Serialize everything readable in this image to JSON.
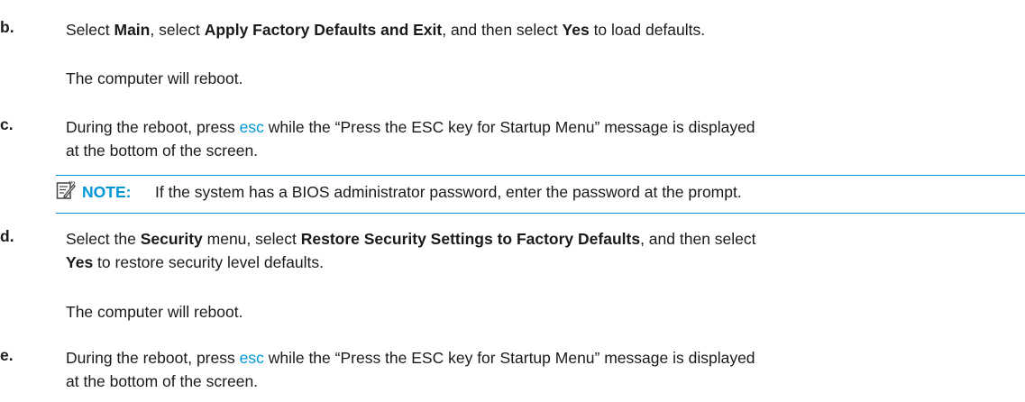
{
  "steps": [
    {
      "letter": "b.",
      "parts": [
        {
          "t": "Select ",
          "s": "n"
        },
        {
          "t": "Main",
          "s": "b"
        },
        {
          "t": ", select ",
          "s": "n"
        },
        {
          "t": "Apply Factory Defaults and Exit",
          "s": "b"
        },
        {
          "t": ", and then select ",
          "s": "n"
        },
        {
          "t": "Yes",
          "s": "b"
        },
        {
          "t": " to load defaults.",
          "s": "n"
        }
      ],
      "after": "The computer will reboot."
    },
    {
      "letter": "c.",
      "line1": [
        {
          "t": "During the reboot, press ",
          "s": "n"
        },
        {
          "t": "esc",
          "s": "k"
        },
        {
          "t": " while the “Press the ESC key for Startup Menu” message is displayed",
          "s": "n"
        }
      ],
      "line2": "at the bottom of the screen."
    },
    {
      "letter": "d.",
      "line1": [
        {
          "t": "Select the ",
          "s": "n"
        },
        {
          "t": "Security",
          "s": "b"
        },
        {
          "t": " menu, select ",
          "s": "n"
        },
        {
          "t": "Restore Security Settings to Factory Defaults",
          "s": "b"
        },
        {
          "t": ", and then select",
          "s": "n"
        }
      ],
      "line2": [
        {
          "t": "Yes",
          "s": "b"
        },
        {
          "t": " to restore security level defaults.",
          "s": "n"
        }
      ],
      "after": "The computer will reboot."
    },
    {
      "letter": "e.",
      "line1": [
        {
          "t": "During the reboot, press ",
          "s": "n"
        },
        {
          "t": "esc",
          "s": "k"
        },
        {
          "t": " while the “Press the ESC key for Startup Menu” message is displayed",
          "s": "n"
        }
      ],
      "line2": "at the bottom of the screen."
    }
  ],
  "note": {
    "icon": "note-icon",
    "label": "NOTE:",
    "text": "If the system has a BIOS administrator password, enter the password at the prompt."
  },
  "colors": {
    "accent": "#0096d6",
    "text": "#1a1a1a"
  }
}
